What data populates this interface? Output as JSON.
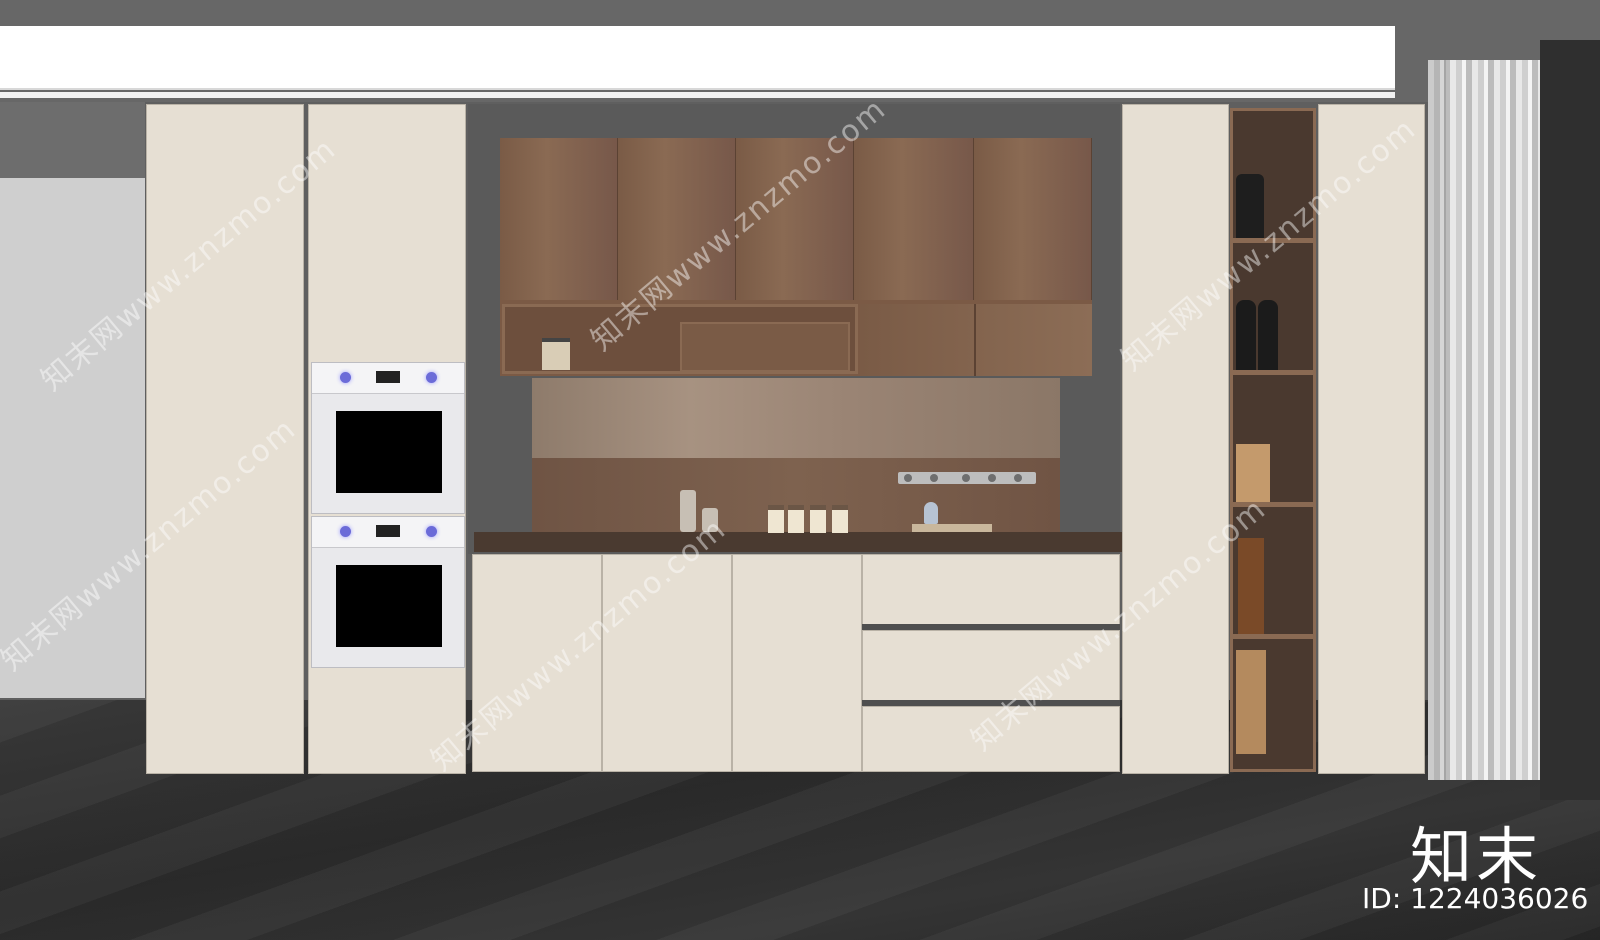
{
  "watermark": {
    "site": "知末网www.znzmo.com",
    "brand": "知末",
    "id_text": "ID: 1224036026"
  },
  "colors": {
    "cabinet_cream": "#e6dfd3",
    "wood": "#7b5a45",
    "floor": "#2f2f2f",
    "oven_knob": "#6b6bd8"
  },
  "icons": [
    "oven-icon",
    "bottle-icon",
    "jar-icon",
    "curtain-icon"
  ]
}
